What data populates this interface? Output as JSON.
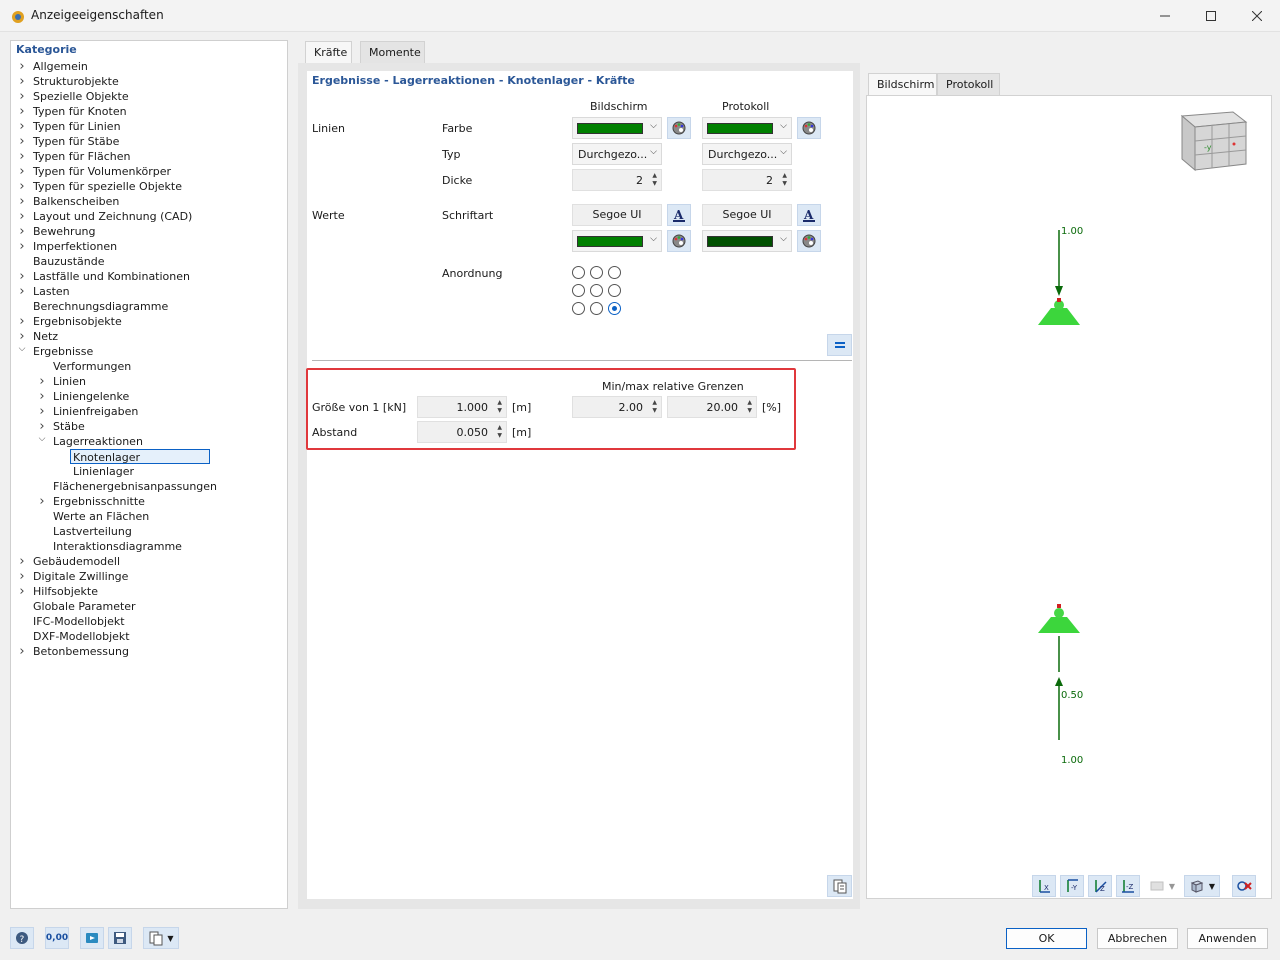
{
  "window": {
    "title": "Anzeigeeigenschaften",
    "minimize_icon": "minimize-icon",
    "maximize_icon": "maximize-icon",
    "close_icon": "close-icon"
  },
  "tree": {
    "heading": "Kategorie",
    "items": [
      {
        "label": "Allgemein",
        "level": 0,
        "expander": "collapsed"
      },
      {
        "label": "Strukturobjekte",
        "level": 0,
        "expander": "collapsed"
      },
      {
        "label": "Spezielle Objekte",
        "level": 0,
        "expander": "collapsed"
      },
      {
        "label": "Typen für Knoten",
        "level": 0,
        "expander": "collapsed"
      },
      {
        "label": "Typen für Linien",
        "level": 0,
        "expander": "collapsed"
      },
      {
        "label": "Typen für Stäbe",
        "level": 0,
        "expander": "collapsed"
      },
      {
        "label": "Typen für Flächen",
        "level": 0,
        "expander": "collapsed"
      },
      {
        "label": "Typen für Volumenkörper",
        "level": 0,
        "expander": "collapsed"
      },
      {
        "label": "Typen für spezielle Objekte",
        "level": 0,
        "expander": "collapsed"
      },
      {
        "label": "Balkenscheiben",
        "level": 0,
        "expander": "collapsed"
      },
      {
        "label": "Layout und Zeichnung (CAD)",
        "level": 0,
        "expander": "collapsed"
      },
      {
        "label": "Bewehrung",
        "level": 0,
        "expander": "collapsed"
      },
      {
        "label": "Imperfektionen",
        "level": 0,
        "expander": "collapsed"
      },
      {
        "label": "Bauzustände",
        "level": 0,
        "expander": "none"
      },
      {
        "label": "Lastfälle und Kombinationen",
        "level": 0,
        "expander": "collapsed"
      },
      {
        "label": "Lasten",
        "level": 0,
        "expander": "collapsed"
      },
      {
        "label": "Berechnungsdiagramme",
        "level": 0,
        "expander": "none"
      },
      {
        "label": "Ergebnisobjekte",
        "level": 0,
        "expander": "collapsed"
      },
      {
        "label": "Netz",
        "level": 0,
        "expander": "collapsed"
      },
      {
        "label": "Ergebnisse",
        "level": 0,
        "expander": "expanded"
      },
      {
        "label": "Verformungen",
        "level": 1,
        "expander": "none"
      },
      {
        "label": "Linien",
        "level": 1,
        "expander": "collapsed"
      },
      {
        "label": "Liniengelenke",
        "level": 1,
        "expander": "collapsed"
      },
      {
        "label": "Linienfreigaben",
        "level": 1,
        "expander": "collapsed"
      },
      {
        "label": "Stäbe",
        "level": 1,
        "expander": "collapsed"
      },
      {
        "label": "Lagerreaktionen",
        "level": 1,
        "expander": "expanded"
      },
      {
        "label": "Knotenlager",
        "level": 2,
        "expander": "none",
        "selected": true
      },
      {
        "label": "Linienlager",
        "level": 2,
        "expander": "none"
      },
      {
        "label": "Flächenergebnisanpassungen",
        "level": 1,
        "expander": "none"
      },
      {
        "label": "Ergebnisschnitte",
        "level": 1,
        "expander": "collapsed"
      },
      {
        "label": "Werte an Flächen",
        "level": 1,
        "expander": "none"
      },
      {
        "label": "Lastverteilung",
        "level": 1,
        "expander": "none"
      },
      {
        "label": "Interaktionsdiagramme",
        "level": 1,
        "expander": "none"
      },
      {
        "label": "Gebäudemodell",
        "level": 0,
        "expander": "collapsed"
      },
      {
        "label": "Digitale Zwillinge",
        "level": 0,
        "expander": "collapsed"
      },
      {
        "label": "Hilfsobjekte",
        "level": 0,
        "expander": "collapsed"
      },
      {
        "label": "Globale Parameter",
        "level": 0,
        "expander": "none"
      },
      {
        "label": "IFC-Modellobjekt",
        "level": 0,
        "expander": "none"
      },
      {
        "label": "DXF-Modellobjekt",
        "level": 0,
        "expander": "none"
      },
      {
        "label": "Betonbemessung",
        "level": 0,
        "expander": "collapsed"
      }
    ]
  },
  "center": {
    "tabs": [
      "Kräfte",
      "Momente"
    ],
    "active_tab": "Kräfte",
    "section_title": "Ergebnisse - Lagerreaktionen - Knotenlager - Kräfte",
    "col_screen": "Bildschirm",
    "col_protocol": "Protokoll",
    "group_lines": "Linien",
    "group_values": "Werte",
    "row_color": "Farbe",
    "row_type": "Typ",
    "row_thickness": "Dicke",
    "row_font": "Schriftart",
    "row_arrangement": "Anordnung",
    "line_type_screen": "Durchgezo...",
    "line_type_protocol": "Durchgezo...",
    "thickness_screen": "2",
    "thickness_protocol": "2",
    "font_screen": "Segoe UI",
    "font_protocol": "Segoe UI",
    "line_color_screen": "#008000",
    "line_color_protocol": "#008000",
    "value_color_screen": "#008000",
    "value_color_protocol": "#005000",
    "arrangement_selected": "bottom-right",
    "limits_header": "Min/max relative Grenzen",
    "size_label": "Größe von 1 [kN]",
    "size_value": "1.000",
    "size_unit": "[m]",
    "limit_min": "2.00",
    "limit_max": "20.00",
    "limit_unit": "[%]",
    "distance_label": "Abstand",
    "distance_value": "0.050",
    "distance_unit": "[m]"
  },
  "preview": {
    "tabs": [
      "Bildschirm",
      "Protokoll"
    ],
    "active_tab": "Bildschirm",
    "label_top": "1.00",
    "label_mid": "0.50",
    "label_bottom": "1.00",
    "nav_cube_left": "-y",
    "toolbar_icons": [
      "view-x-icon",
      "view-minus-y-icon",
      "view-z-icon",
      "view-minus-z-icon",
      "render-mode-icon",
      "box-view-icon",
      "reset-view-icon"
    ]
  },
  "footer": {
    "ok": "OK",
    "cancel": "Abbrechen",
    "apply": "Anwenden",
    "icons": [
      "help-icon",
      "units-icon",
      "import-icon",
      "save-icon",
      "clipboard-menu-icon"
    ],
    "units_text": "0,00"
  }
}
